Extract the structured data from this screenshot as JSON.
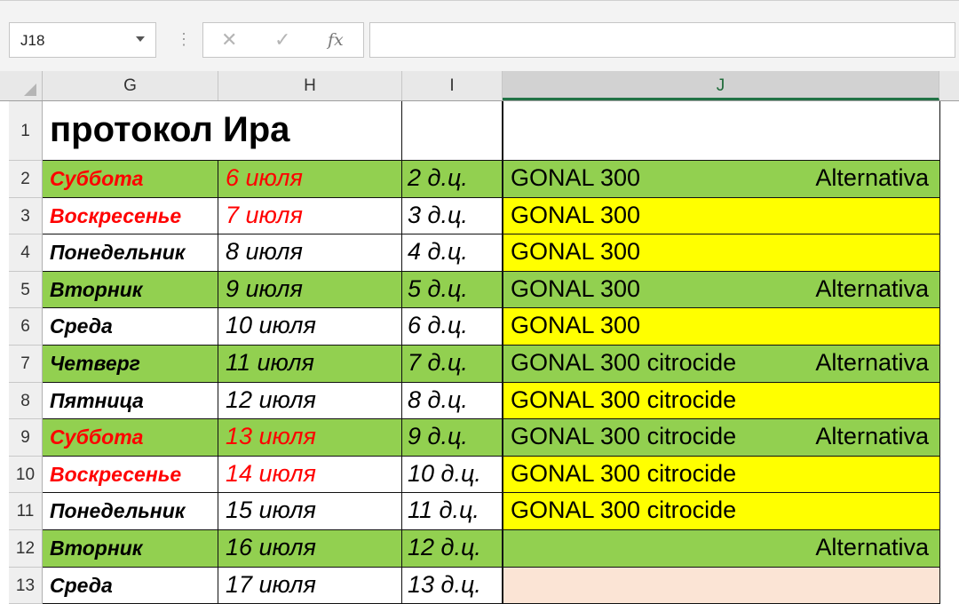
{
  "formula_bar": {
    "name_box": "J18",
    "icons": {
      "cancel": "close-icon",
      "enter": "check-icon",
      "function": "fx-icon"
    },
    "fx_label": "fx",
    "formula": ""
  },
  "sheet": {
    "columns": [
      "G",
      "H",
      "I",
      "J"
    ],
    "active_column": "J",
    "colors": {
      "green": "#92d050",
      "yellow": "#ffff00",
      "peach": "#fbe4d5",
      "red": "#ff0000",
      "black": "#000000"
    },
    "title": "протокол Ира",
    "rows": [
      {
        "n": "2",
        "day": "Суббота",
        "date": "6 июля",
        "dc": "2 д.ц.",
        "drug": "GONAL 300",
        "note": "Alternativa",
        "fill": "green",
        "red": true
      },
      {
        "n": "3",
        "day": "Воскресенье",
        "date": "7 июля",
        "dc": "3 д.ц.",
        "drug": "GONAL 300",
        "note": "",
        "fill": "yellow",
        "red": true
      },
      {
        "n": "4",
        "day": "Понедельник",
        "date": "8 июля",
        "dc": "4 д.ц.",
        "drug": "GONAL 300",
        "note": "",
        "fill": "yellow",
        "red": false
      },
      {
        "n": "5",
        "day": "Вторник",
        "date": "9 июля",
        "dc": "5 д.ц.",
        "drug": "GONAL 300",
        "note": "Alternativa",
        "fill": "green",
        "red": false
      },
      {
        "n": "6",
        "day": "Среда",
        "date": "10 июля",
        "dc": "6 д.ц.",
        "drug": "GONAL 300",
        "note": "",
        "fill": "yellow",
        "red": false
      },
      {
        "n": "7",
        "day": "Четверг",
        "date": "11 июля",
        "dc": "7 д.ц.",
        "drug": "GONAL 300 citrocide",
        "note": "Alternativa",
        "fill": "green",
        "red": false
      },
      {
        "n": "8",
        "day": "Пятница",
        "date": "12 июля",
        "dc": "8 д.ц.",
        "drug": "GONAL 300 citrocide",
        "note": "",
        "fill": "yellow",
        "red": false
      },
      {
        "n": "9",
        "day": "Суббота",
        "date": "13 июля",
        "dc": "9 д.ц.",
        "drug": "GONAL 300 citrocide",
        "note": "Alternativa",
        "fill": "green",
        "red": true
      },
      {
        "n": "10",
        "day": "Воскресенье",
        "date": "14 июля",
        "dc": "10 д.ц.",
        "drug": "GONAL 300 citrocide",
        "note": "",
        "fill": "yellow",
        "red": true
      },
      {
        "n": "11",
        "day": "Понедельник",
        "date": "15 июля",
        "dc": "11 д.ц.",
        "drug": "GONAL 300 citrocide",
        "note": "",
        "fill": "yellow",
        "red": false
      },
      {
        "n": "12",
        "day": "Вторник",
        "date": "16 июля",
        "dc": "12 д.ц.",
        "drug": "",
        "note": "Alternativa",
        "fill": "green",
        "red": false
      },
      {
        "n": "13",
        "day": "Среда",
        "date": "17 июля",
        "dc": "13 д.ц.",
        "drug": "",
        "note": "",
        "fill": "peach",
        "red": false
      }
    ]
  }
}
